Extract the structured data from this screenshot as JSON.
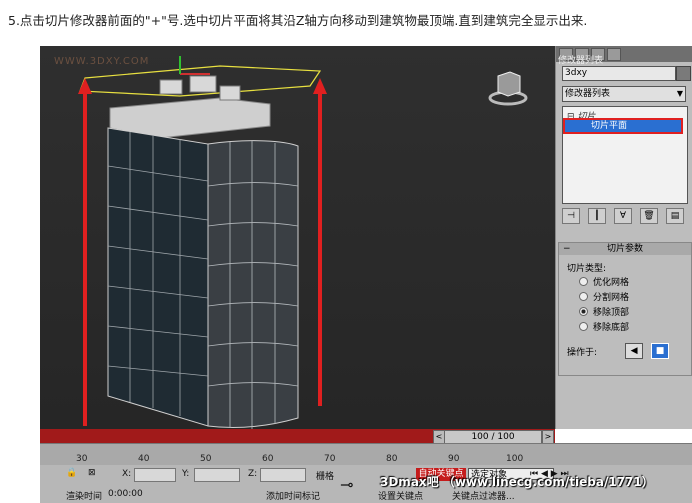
{
  "caption": "5.点击切片修改器前面的\"+\"号.选中切片平面将其沿Z轴方向移动到建筑物最顶端.直到建筑完全显示出来.",
  "viewport": {
    "watermark": "WWW.3DXY.COM"
  },
  "panel": {
    "tab_label": "修改器列表",
    "object_name": "3dxy",
    "modifier_list": "修改器列表",
    "stack": {
      "slice": "切片",
      "slice_plane": "切片平面"
    },
    "rollout_title": "切片参数",
    "slice_type_label": "切片类型:",
    "options": [
      "优化网格",
      "分割网格",
      "移除顶部",
      "移除底部"
    ],
    "selected_option": "移除顶部",
    "operate_label": "操作于:"
  },
  "timeline": {
    "frame_display": "100 / 100",
    "ticks": [
      "30",
      "40",
      "50",
      "60",
      "70",
      "80",
      "90",
      "100"
    ]
  },
  "status": {
    "x_label": "X:",
    "y_label": "Y:",
    "z_label": "Z:",
    "grid": "栅格",
    "render_time_label": "渲染时间",
    "render_time": "0:00:00",
    "add_time_tag": "添加时间标记",
    "auto_key": "自动关键点",
    "selected_object": "选定对象",
    "set_key": "设置关键点",
    "key_filter": "关键点过滤器...",
    "overlay_url": "3Dmax吧 （www.linecg.com/tieba/1771）"
  },
  "colors": {
    "accent_red": "#e02020",
    "selection_blue": "#2a6fd1"
  }
}
